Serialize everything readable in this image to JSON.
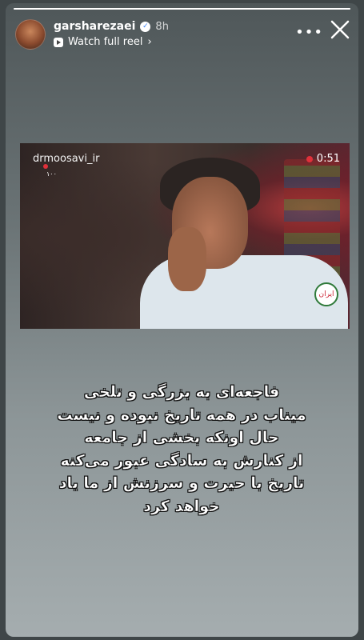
{
  "header": {
    "username": "garsharezaei",
    "time": "8h",
    "watch_reel_label": "Watch full reel",
    "watch_reel_chevron": "›",
    "more_label": "•••"
  },
  "progress": {
    "fraction": 1.0
  },
  "video": {
    "channel_handle": "drmoosavi_ir",
    "channel_badge": "۱۰۰",
    "timer": "0:51",
    "logo_text": "ایران"
  },
  "caption": {
    "lines": [
      "فاجعه‌ای به بزرگی و تلخی",
      "میناب در همه تاریخ نبوده و نیست",
      "حال اونکه بخشی از جامعه",
      "از کنارش به سادگی عبور می‌کنه",
      "تاریخ با حیرت و سرزنش از ما یاد",
      "خواهد کرد"
    ]
  },
  "icons": {
    "verified": "verified-badge-icon",
    "reel": "reel-icon",
    "more": "more-icon",
    "close": "close-icon"
  },
  "colors": {
    "background": "#3f4648",
    "rec": "#e0303a",
    "verified": "#3b82f6"
  }
}
